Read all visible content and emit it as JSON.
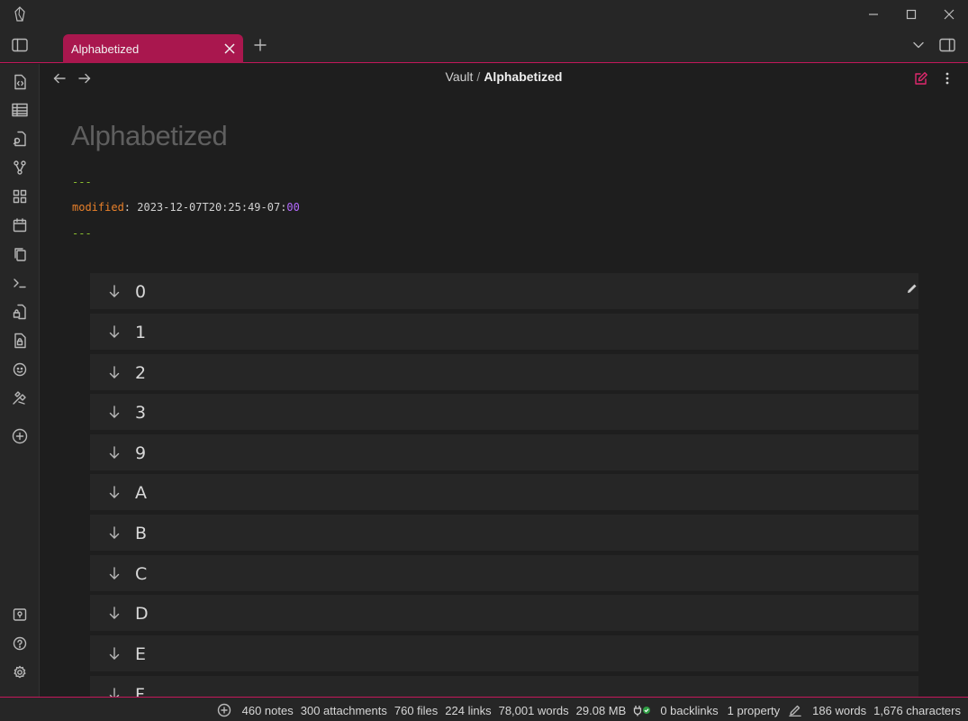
{
  "tab": {
    "title": "Alphabetized"
  },
  "breadcrumb": {
    "vault": "Vault",
    "separator": "/",
    "current": "Alphabetized"
  },
  "note": {
    "title": "Alphabetized",
    "frontmatter_delim": "---",
    "frontmatter_key": "modified",
    "frontmatter_colon": ": ",
    "frontmatter_value": "2023-12-07T20:25:49-07:",
    "frontmatter_value_tail": "00"
  },
  "groups": [
    "0",
    "1",
    "2",
    "3",
    "9",
    "A",
    "B",
    "C",
    "D",
    "E",
    "F"
  ],
  "status": {
    "notes": "460 notes",
    "attachments": "300 attachments",
    "files": "760 files",
    "links": "224 links",
    "words_vault": "78,001 words",
    "size": "29.08 MB",
    "backlinks": "0 backlinks",
    "properties": "1 property",
    "words_note": "186 words",
    "characters": "1,676 characters"
  },
  "colors": {
    "accent": "#a9174e",
    "accent_border": "#c4185b",
    "frontmatter_key": "#e8802a",
    "frontmatter_dash": "#8bbf2f",
    "number_tail": "#b469ff"
  },
  "icons": {
    "ribbon": [
      "file-code-icon",
      "table-icon",
      "file-search-icon",
      "graph-icon",
      "grid-icon",
      "calendar-icon",
      "copy-icon",
      "terminal-icon",
      "file-lock-icon",
      "lock-file-icon",
      "face-icon",
      "tools-icon",
      "add-circle-icon",
      "vault-icon",
      "help-icon",
      "settings-icon"
    ]
  }
}
